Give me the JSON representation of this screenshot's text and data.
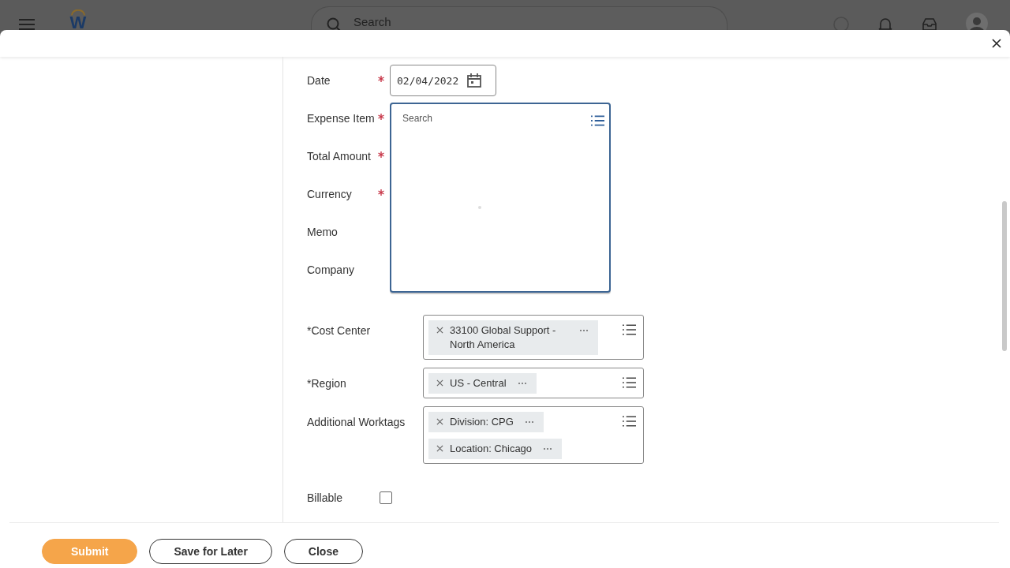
{
  "top_bar": {
    "brand_mark": "W",
    "search_placeholder": "Search"
  },
  "fields": [
    {
      "label": "Date",
      "required": true,
      "kind": "date",
      "value": "02/04/2022"
    },
    {
      "label": "Expense Item",
      "required": true,
      "kind": "search",
      "placeholder": "Search",
      "expanded": true
    },
    {
      "label": "Total Amount",
      "required": true,
      "kind": "covered"
    },
    {
      "label": "Currency",
      "required": true,
      "kind": "covered"
    },
    {
      "label": "Memo",
      "required": false,
      "kind": "covered"
    },
    {
      "label": "Company",
      "required": false,
      "kind": "covered"
    }
  ],
  "worktags": [
    {
      "label": "*Cost Center",
      "tags": [
        "33100 Global Support - North America"
      ]
    },
    {
      "label": "*Region",
      "tags": [
        "US - Central"
      ]
    },
    {
      "label": "Additional Worktags",
      "tags": [
        "Division: CPG",
        "Location: Chicago"
      ]
    }
  ],
  "billable": {
    "label": "Billable",
    "checked": false
  },
  "buttons": [
    {
      "label": "Submit",
      "primary": true
    },
    {
      "label": "Save for Later",
      "primary": false
    },
    {
      "label": "Close",
      "primary": false
    }
  ]
}
